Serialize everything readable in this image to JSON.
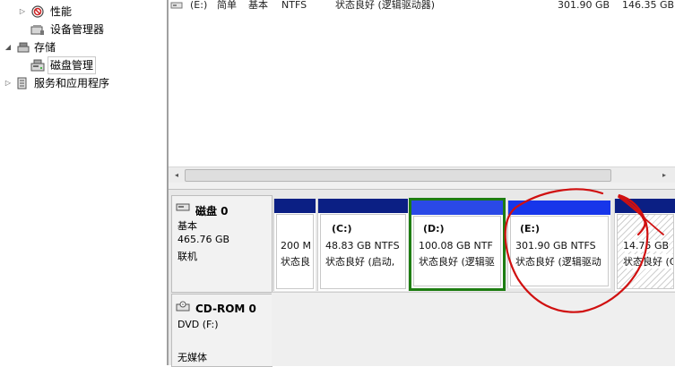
{
  "tree": {
    "items": [
      {
        "label": "性能",
        "icon": "performance-icon",
        "expand": "▷"
      },
      {
        "label": "设备管理器",
        "icon": "device-manager-icon",
        "expand": ""
      },
      {
        "label": "存储",
        "icon": "storage-icon",
        "expand": "◢"
      },
      {
        "label": "磁盘管理",
        "icon": "disk-management-icon",
        "expand": ""
      },
      {
        "label": "服务和应用程序",
        "icon": "services-apps-icon",
        "expand": "▷"
      }
    ]
  },
  "list": {
    "row": {
      "volume": "(E:)",
      "layout": "简单",
      "type": "基本",
      "fs": "NTFS",
      "status": "状态良好 (逻辑驱动器)",
      "capacity": "301.90 GB",
      "free": "146.35 GB"
    }
  },
  "scrollbar": {
    "left": "◂",
    "right": "▸"
  },
  "disks": [
    {
      "name": "磁盘 0",
      "type": "基本",
      "size": "465.76 GB",
      "status": "联机",
      "volumes": [
        {
          "title": "",
          "line1": "200 M",
          "line2": "状态良"
        },
        {
          "title": "(C:)",
          "line1": "48.83 GB NTFS",
          "line2": "状态良好 (启动,"
        },
        {
          "title": "(D:)",
          "line1": "100.08 GB NTF",
          "line2": "状态良好 (逻辑驱"
        },
        {
          "title": "(E:)",
          "line1": "301.90 GB NTFS",
          "line2": "状态良好 (逻辑驱动"
        },
        {
          "title": "",
          "line1": "14.75 GB",
          "line2": "状态良好 (C"
        }
      ]
    },
    {
      "name": "CD-ROM 0",
      "type": "DVD (F:)",
      "status": "无媒体"
    }
  ],
  "colors": {
    "primary_bar": "#0b1f84",
    "selected_border": "#1e7d12",
    "annotation": "#d01010"
  }
}
